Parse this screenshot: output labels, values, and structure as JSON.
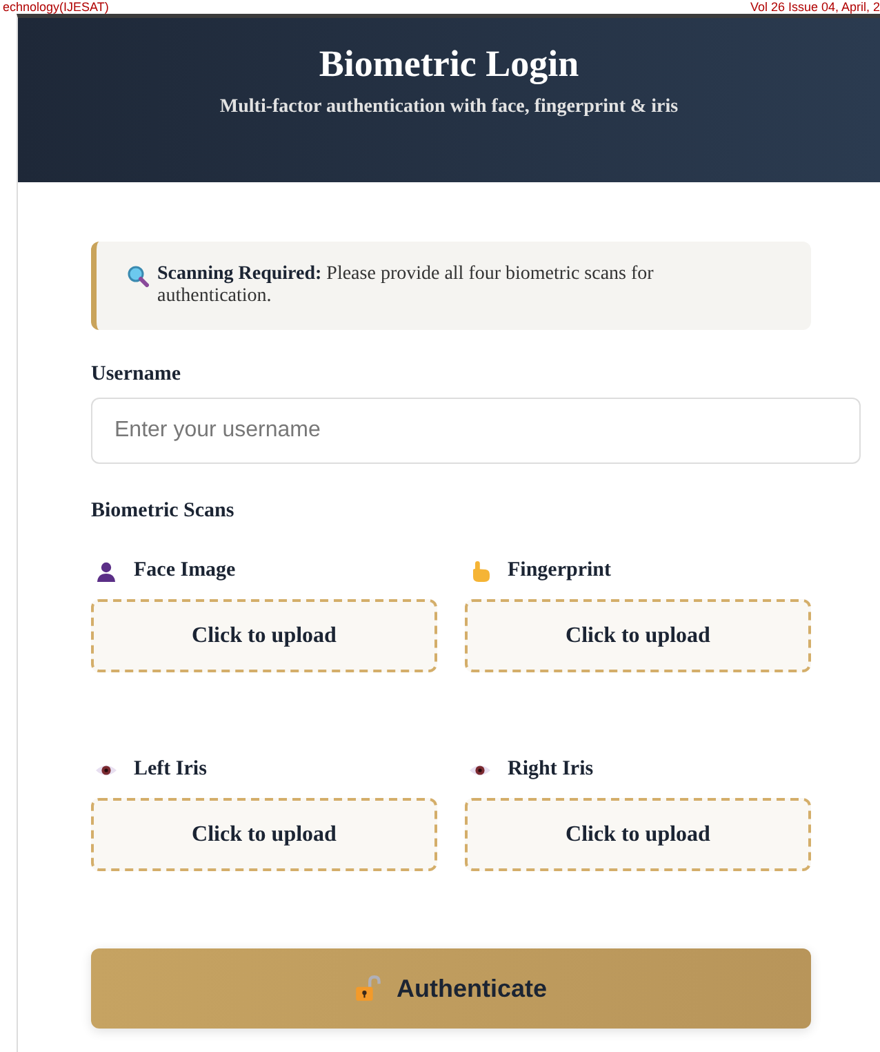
{
  "page_header": {
    "left": "echnology(IJESAT)",
    "right": "Vol 26 Issue 04, April, 2"
  },
  "header": {
    "title": "Biometric Login",
    "subtitle": "Multi-factor authentication with face, fingerprint & iris"
  },
  "alert": {
    "text": "**Scanning Required:** Please provide all four biometric scans for authentication."
  },
  "username": {
    "label": "Username",
    "placeholder": "Enter your username"
  },
  "scans_title": "Biometric Scans",
  "scans": [
    {
      "label": "Face Image",
      "upload": "Click to upload"
    },
    {
      "label": "Fingerprint",
      "upload": "Click to upload"
    },
    {
      "label": "Left Iris",
      "upload": "Click to upload"
    },
    {
      "label": "Right Iris",
      "upload": "Click to upload"
    }
  ],
  "submit": "Authenticate"
}
